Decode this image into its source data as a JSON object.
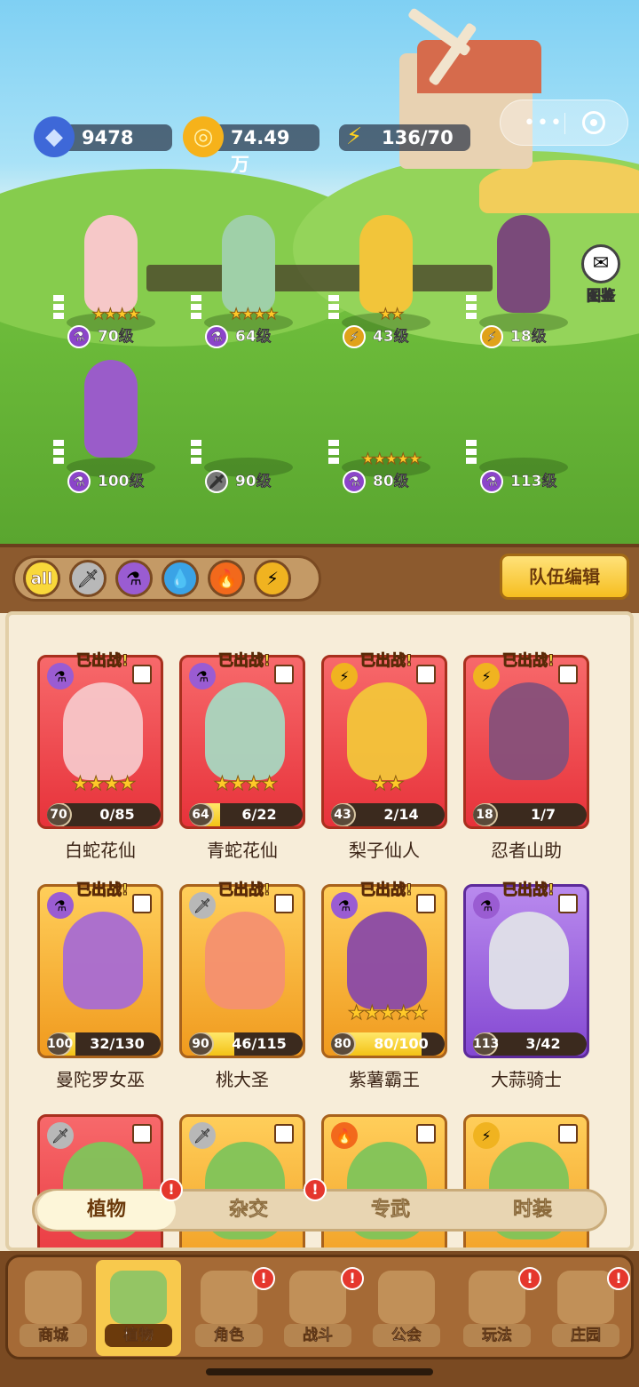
{
  "resources": {
    "gems": "9478",
    "coins": "74.49万",
    "energy": "136/70"
  },
  "top_right": {
    "atlas_label": "图鉴"
  },
  "lineup": [
    {
      "level": "70级",
      "stars": "★★★★",
      "element": "potion"
    },
    {
      "level": "64级",
      "stars": "★★★★",
      "element": "potion"
    },
    {
      "level": "43级",
      "stars": "★★",
      "element": "lightning"
    },
    {
      "level": "18级",
      "stars": "",
      "element": "lightning"
    },
    {
      "level": "100级",
      "stars": "",
      "element": "potion"
    },
    {
      "level": "90级",
      "stars": "",
      "element": "sword"
    },
    {
      "level": "80级",
      "stars": "★★★★★",
      "element": "potion"
    },
    {
      "level": "113级",
      "stars": "",
      "element": "potion"
    }
  ],
  "filters": {
    "all_label": "all",
    "items": [
      "sword",
      "potion",
      "water",
      "fire",
      "lightning"
    ]
  },
  "team_edit_label": "队伍编辑",
  "cards": [
    {
      "name": "白蛇花仙",
      "level": "70",
      "progress": "0/85",
      "fraction": 0.0,
      "stars": "★★★★",
      "deployed": "已出战!",
      "rarity": "red",
      "element": "potion"
    },
    {
      "name": "青蛇花仙",
      "level": "64",
      "progress": "6/22",
      "fraction": 0.27,
      "stars": "★★★★",
      "deployed": "已出战!",
      "rarity": "red",
      "element": "potion"
    },
    {
      "name": "梨子仙人",
      "level": "43",
      "progress": "2/14",
      "fraction": 0.14,
      "stars": "★★",
      "deployed": "已出战!",
      "rarity": "red",
      "element": "lightning"
    },
    {
      "name": "忍者山助",
      "level": "18",
      "progress": "1/7",
      "fraction": 0.14,
      "stars": "",
      "deployed": "已出战!",
      "rarity": "red",
      "element": "lightning"
    },
    {
      "name": "曼陀罗女巫",
      "level": "100",
      "progress": "32/130",
      "fraction": 0.25,
      "stars": "",
      "deployed": "已出战!",
      "rarity": "gold",
      "element": "potion"
    },
    {
      "name": "桃大圣",
      "level": "90",
      "progress": "46/115",
      "fraction": 0.4,
      "stars": "",
      "deployed": "已出战!",
      "rarity": "gold",
      "element": "sword"
    },
    {
      "name": "紫薯霸王",
      "level": "80",
      "progress": "80/100",
      "fraction": 0.8,
      "stars": "★★★★★",
      "deployed": "已出战!",
      "rarity": "gold",
      "element": "potion"
    },
    {
      "name": "大蒜骑士",
      "level": "113",
      "progress": "3/42",
      "fraction": 0.07,
      "stars": "",
      "deployed": "已出战!",
      "rarity": "purple",
      "element": "potion"
    }
  ],
  "tabs": [
    "植物",
    "杂交",
    "专武",
    "时装"
  ],
  "badge_symbol": "!",
  "nav": [
    "商城",
    "植物",
    "角色",
    "战斗",
    "公会",
    "玩法",
    "庄园"
  ],
  "colors": {
    "deployed_text": "#ffe34a",
    "alert_badge": "#e5372d",
    "active_nav": "#f8c94d"
  }
}
